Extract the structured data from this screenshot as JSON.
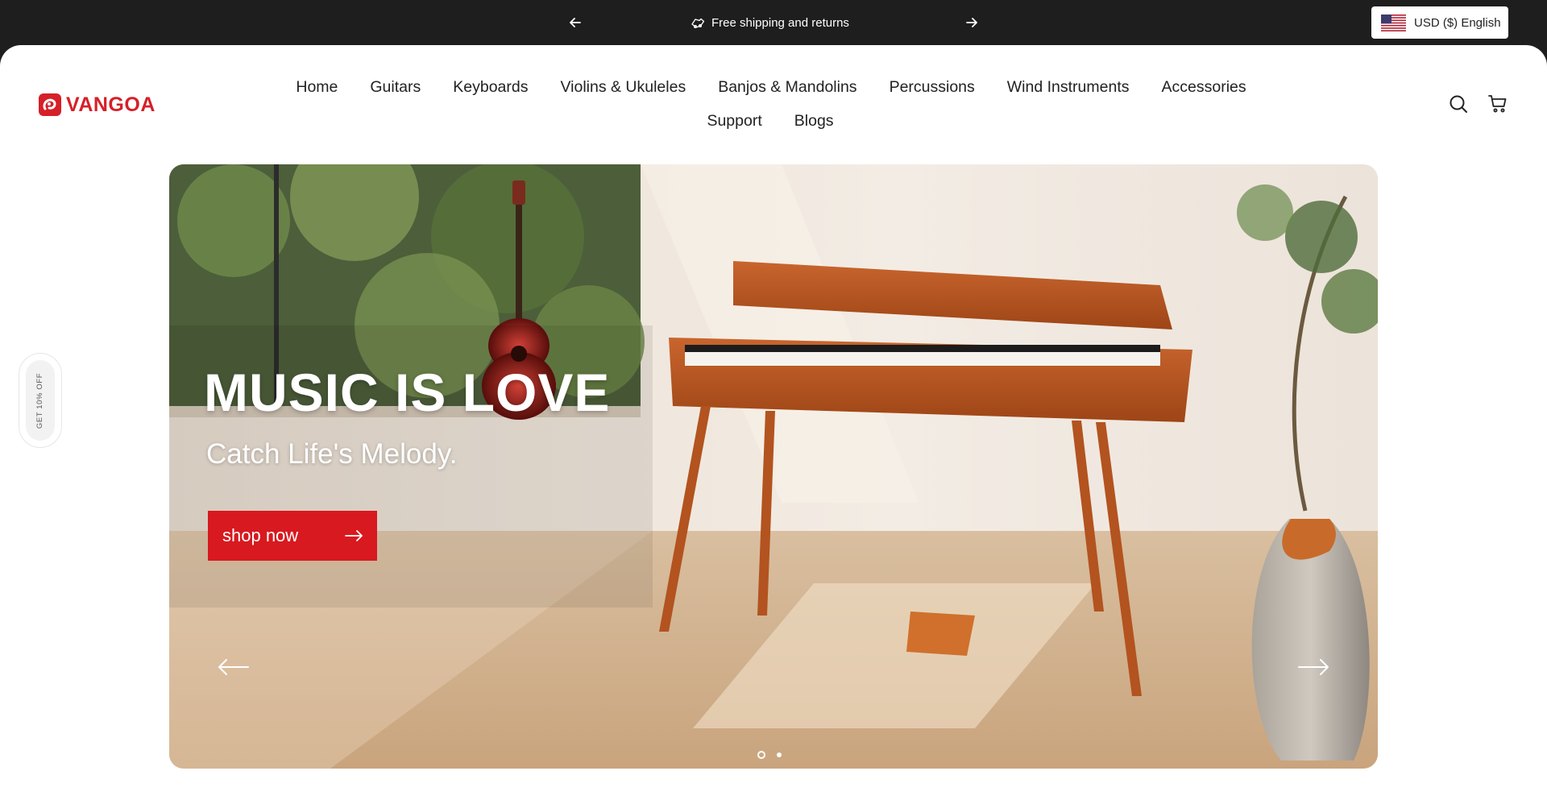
{
  "announcement": {
    "message": "Free shipping and returns",
    "message_icon": "truck-icon",
    "prev_icon": "arrow-left-icon",
    "next_icon": "arrow-right-icon"
  },
  "localization": {
    "label": "USD ($) English",
    "flag_icon": "us-flag-icon"
  },
  "brand": {
    "name": "VANGOA",
    "color": "#d62028"
  },
  "nav": {
    "primary": [
      "Home",
      "Guitars",
      "Keyboards",
      "Violins & Ukuleles",
      "Banjos & Mandolins",
      "Percussions",
      "Wind Instruments",
      "Accessories"
    ],
    "secondary": [
      "Support",
      "Blogs"
    ]
  },
  "header_icons": [
    "search-icon",
    "cart-icon"
  ],
  "side_tab": {
    "label": "GET 10% OFF"
  },
  "hero": {
    "title": "MUSIC IS LOVE",
    "subtitle": "Catch Life's Melody.",
    "button_label": "shop now",
    "button_color": "#d8191f",
    "slide_count": 2,
    "active_slide": 1
  }
}
